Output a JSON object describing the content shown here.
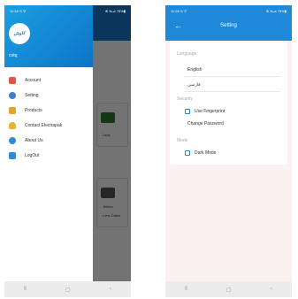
{
  "left_screen": {
    "status": {
      "time": "11:28 ⊙ ⚲",
      "right": "⊕ ‰⊿ 75%▮"
    },
    "background_cards": [
      "Lens",
      "Jerkes",
      "Lens Dates"
    ],
    "drawer": {
      "logo_text": "کاوش",
      "username": "cotq",
      "items": [
        {
          "label": "Account",
          "icon": "person-icon",
          "color": "#e2583e"
        },
        {
          "label": "Setting",
          "icon": "gear-icon",
          "color": "#3f7fc9"
        },
        {
          "label": "Products",
          "icon": "products-icon",
          "color": "#e8a22a"
        },
        {
          "label": "Contact Electrapak",
          "icon": "heart-hand-icon",
          "color": "#e9b230"
        },
        {
          "label": "About Us",
          "icon": "info-icon",
          "color": "#2f8ad8"
        },
        {
          "label": "LogOut",
          "icon": "logout-icon",
          "color": "#2f8ad8"
        }
      ]
    }
  },
  "right_screen": {
    "status": {
      "time": "11:28 ⊙ ⚲",
      "right": "⊕ ‰⊿ 75%▮"
    },
    "appbar": {
      "back_glyph": "←",
      "title": "Setting"
    },
    "language": {
      "label": "Language",
      "options": [
        "English",
        "فارسی"
      ]
    },
    "security": {
      "label": "Security",
      "fingerprint": "Use Fingerprint",
      "change_password": "Change Password"
    },
    "mode": {
      "label": "Mode",
      "dark_mode": "Dark Mode"
    }
  },
  "navbar": {
    "recent": "⦀",
    "home": "▢",
    "back": "‹"
  },
  "colors": {
    "primary": "#1e88d9",
    "drawer_header": "#0d74c6",
    "scrim": "rgba(0,0,0,0.55)"
  }
}
